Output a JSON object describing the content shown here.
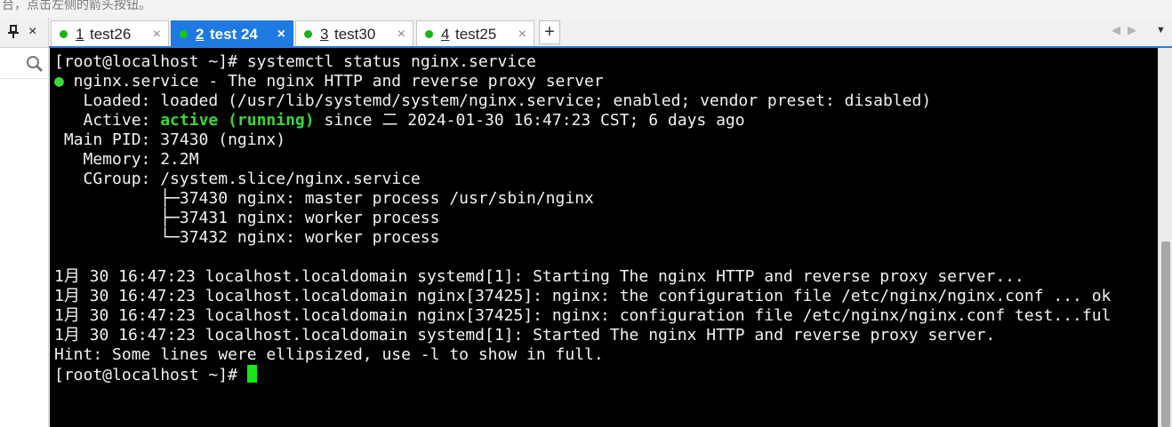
{
  "banner": {
    "text": "台，点击左侧的箭头按钮。"
  },
  "left_pane": {
    "pin_icon": "pin-icon",
    "close_icon": "close-icon",
    "close_label": "×",
    "search_icon": "search-icon"
  },
  "tabs": [
    {
      "num": "1",
      "name": "test26",
      "status": "connected",
      "active": false
    },
    {
      "num": "2",
      "name": "test 24",
      "status": "connected",
      "active": true
    },
    {
      "num": "3",
      "name": "test30",
      "status": "connected",
      "active": false
    },
    {
      "num": "4",
      "name": "test25",
      "status": "connected",
      "active": false
    }
  ],
  "tab_close_label": "×",
  "new_tab_label": "+",
  "nav": {
    "prev": "◀",
    "next": "▶",
    "menu": "▼"
  },
  "colors": {
    "accent": "#1e7ae0",
    "status_dot": "#18b418",
    "terminal_bg": "#000000",
    "active_text": "#3ad83a",
    "cursor": "#17e517"
  },
  "terminal": {
    "prompt": "[root@localhost ~]# ",
    "command": "systemctl status nginx.service",
    "bullet": "●",
    "unit_line": " nginx.service - The nginx HTTP and reverse proxy server",
    "loaded": "   Loaded: loaded (/usr/lib/systemd/system/nginx.service; enabled; vendor preset: disabled)",
    "active_label": "   Active: ",
    "active_state": "active (running)",
    "active_since": " since 二 2024-01-30 16:47:23 CST; 6 days ago",
    "main_pid": " Main PID: 37430 (nginx)",
    "memory": "   Memory: 2.2M",
    "cgroup": "   CGroup: /system.slice/nginx.service",
    "proc1": "           ├─37430 nginx: master process /usr/sbin/nginx",
    "proc2": "           ├─37431 nginx: worker process",
    "proc3": "           └─37432 nginx: worker process",
    "log1": "1月 30 16:47:23 localhost.localdomain systemd[1]: Starting The nginx HTTP and reverse proxy server...",
    "log2": "1月 30 16:47:23 localhost.localdomain nginx[37425]: nginx: the configuration file /etc/nginx/nginx.conf ... ok",
    "log3": "1月 30 16:47:23 localhost.localdomain nginx[37425]: nginx: configuration file /etc/nginx/nginx.conf test...ful",
    "log4": "1月 30 16:47:23 localhost.localdomain systemd[1]: Started The nginx HTTP and reverse proxy server.",
    "hint": "Hint: Some lines were ellipsized, use -l to show in full.",
    "final_prompt": "[root@localhost ~]# "
  }
}
